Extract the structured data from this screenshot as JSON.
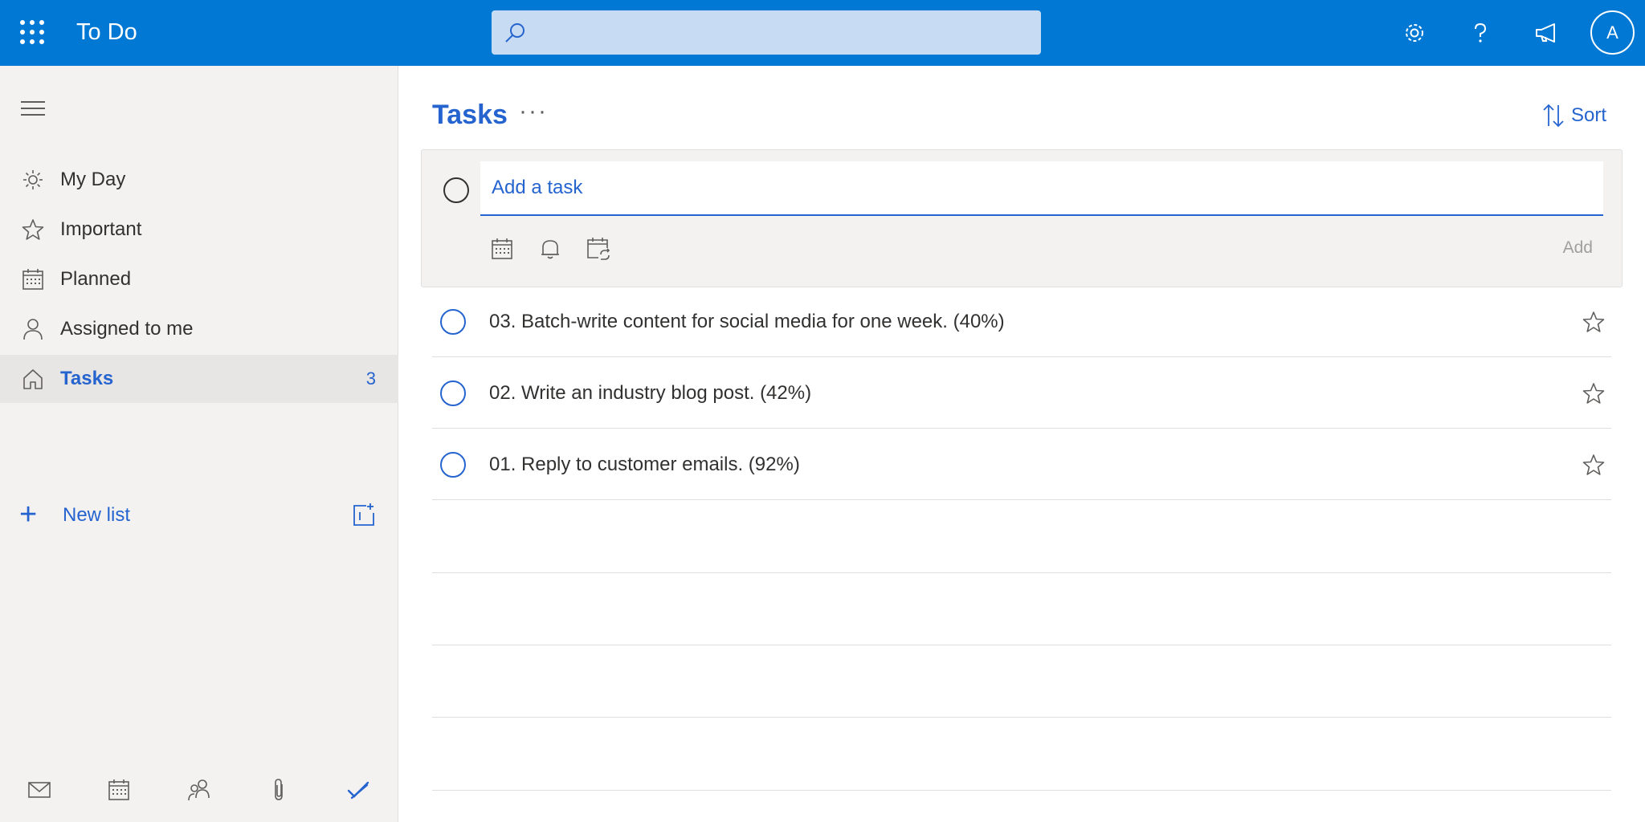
{
  "header": {
    "app_title": "To Do",
    "search_placeholder": "",
    "avatar_initial": "A"
  },
  "sidebar": {
    "items": [
      {
        "label": "My Day",
        "icon": "sun-icon"
      },
      {
        "label": "Important",
        "icon": "star-icon"
      },
      {
        "label": "Planned",
        "icon": "calendar-icon"
      },
      {
        "label": "Assigned to me",
        "icon": "person-icon"
      },
      {
        "label": "Tasks",
        "icon": "home-icon",
        "count": "3",
        "active": true
      }
    ],
    "new_list_label": "New list"
  },
  "main": {
    "list_title": "Tasks",
    "more_label": "···",
    "sort_label": "Sort",
    "add_task_placeholder": "Add a task",
    "add_button_label": "Add",
    "tasks": [
      {
        "title": "03. Batch-write content for social media for one week. (40%)"
      },
      {
        "title": "02. Write an industry blog post. (42%)"
      },
      {
        "title": "01. Reply to customer emails. (92%)"
      }
    ]
  },
  "colors": {
    "header_bg": "#0078d4",
    "accent": "#2564cf",
    "sidebar_bg": "#f3f2f1"
  }
}
